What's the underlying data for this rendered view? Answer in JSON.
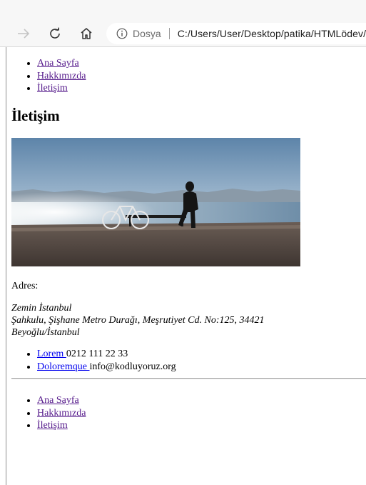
{
  "browser": {
    "site_label": "Dosya",
    "url": "C:/Users/User/Desktop/patika/HTMLödev/l",
    "icons": [
      "forward-arrow-icon",
      "reload-icon",
      "home-icon",
      "info-icon"
    ]
  },
  "nav": {
    "items": [
      {
        "label": "Ana Sayfa"
      },
      {
        "label": "Hakkımızda"
      },
      {
        "label": "İletişim"
      }
    ]
  },
  "page": {
    "title": "İletişim"
  },
  "address": {
    "label": "Adres:",
    "lines": [
      "Zemin İstanbul",
      "Şahkulu, Şişhane Metro Durağı, Meşrutiyet Cd. No:125, 34421",
      "Beyoğlu/İstanbul"
    ]
  },
  "contact": {
    "items": [
      {
        "link": "Lorem ",
        "value": "0212 111 22 33"
      },
      {
        "link": "Doloremque ",
        "value": "info@kodluyoruz.org"
      }
    ]
  },
  "footer_nav": {
    "items": [
      {
        "label": "Ana Sayfa"
      },
      {
        "label": "Hakkımızda"
      },
      {
        "label": "İletişim"
      }
    ]
  },
  "colors": {
    "visited_link": "#551a8b",
    "link": "#0000ee"
  }
}
